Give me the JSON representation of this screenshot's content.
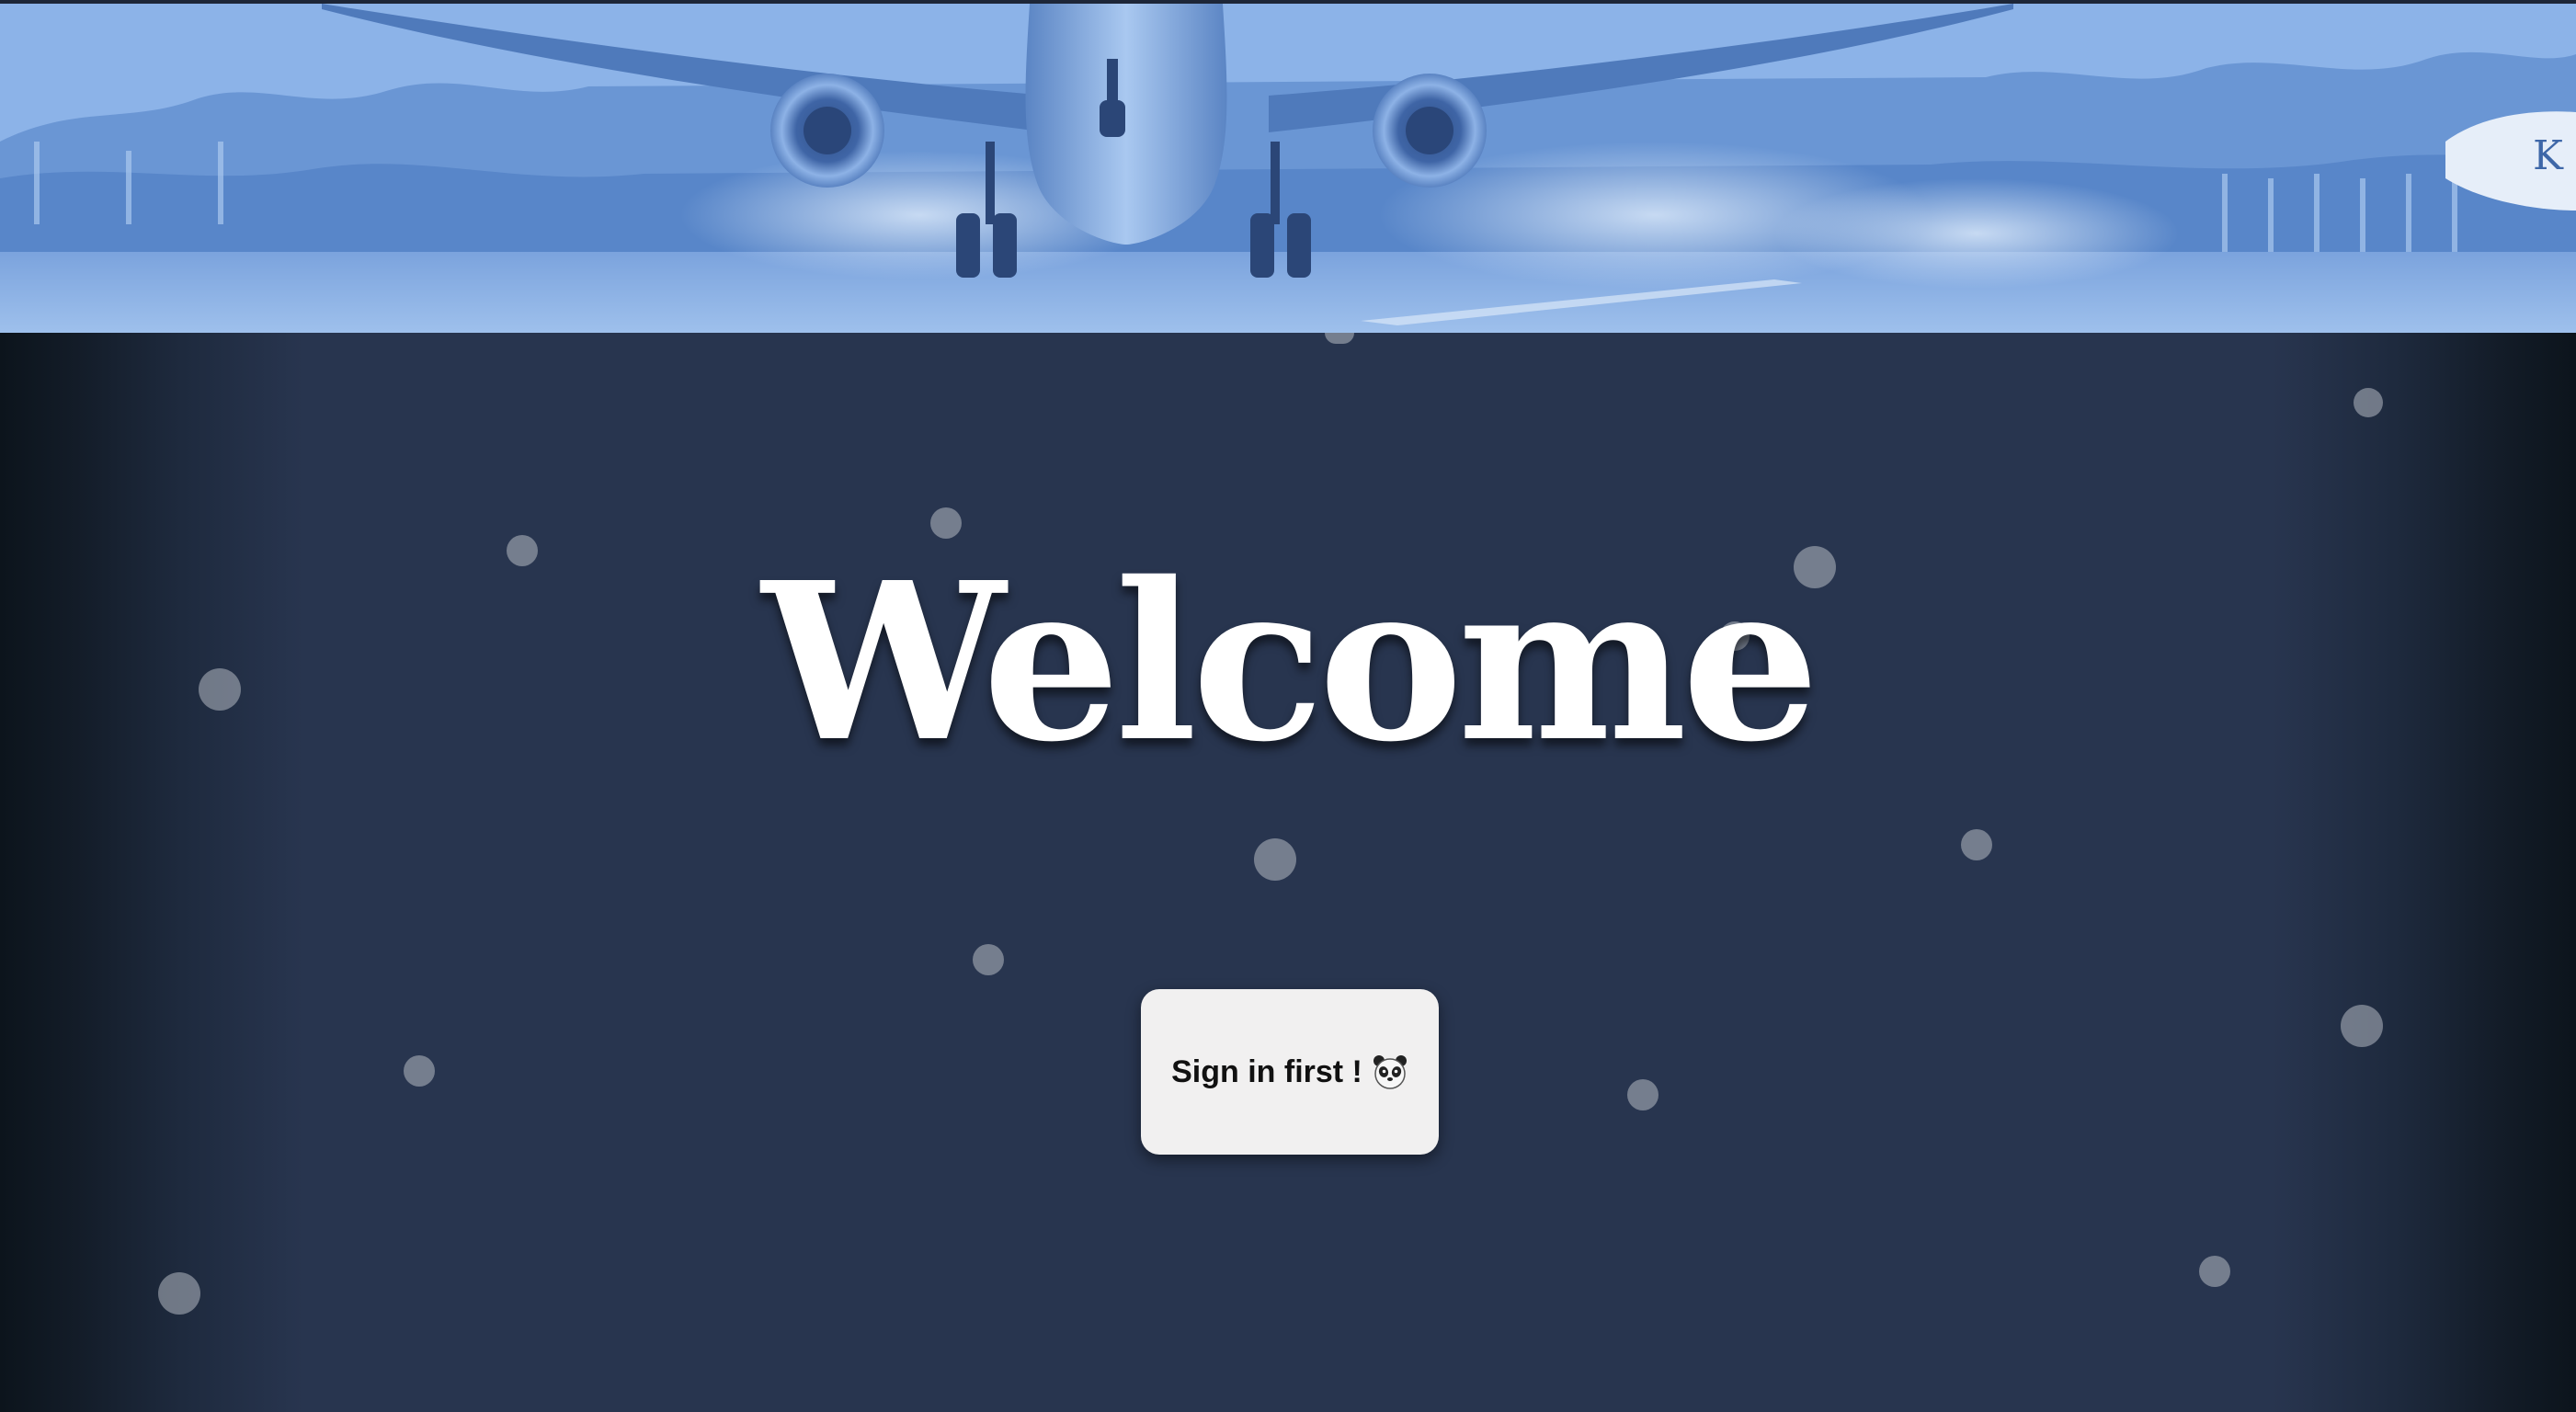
{
  "hero": {
    "tint": "#7ea8e2"
  },
  "main": {
    "background": "#28354f",
    "heading": "Welcome",
    "signin_button": {
      "label": "Sign in first !",
      "icon": "panda-face-icon"
    }
  }
}
